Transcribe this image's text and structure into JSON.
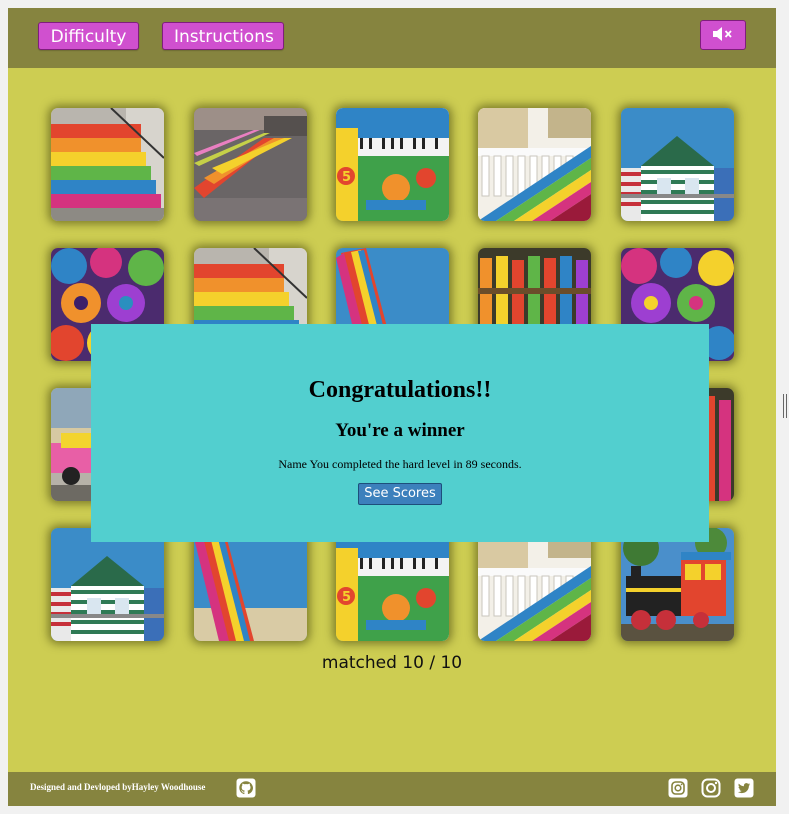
{
  "header": {
    "difficulty_label": "Difficulty",
    "instructions_label": "Instructions",
    "mute_icon": "speaker-muted-icon"
  },
  "cards": [
    {
      "image": "rainbow-stairs"
    },
    {
      "image": "rainbow-crosswalk"
    },
    {
      "image": "painted-piano"
    },
    {
      "image": "rainbow-stair-railing"
    },
    {
      "image": "striped-beach-house"
    },
    {
      "image": "rainbow-roses"
    },
    {
      "image": "rainbow-stairs"
    },
    {
      "image": "striped-deck-chair"
    },
    {
      "image": "rainbow-fence"
    },
    {
      "image": "rainbow-roses"
    },
    {
      "image": "pink-car"
    },
    {
      "image": "hidden-card"
    },
    {
      "image": "hidden-card"
    },
    {
      "image": "hidden-card"
    },
    {
      "image": "rainbow-fence"
    },
    {
      "image": "striped-beach-house"
    },
    {
      "image": "striped-deck-chair"
    },
    {
      "image": "painted-piano"
    },
    {
      "image": "rainbow-stair-railing"
    },
    {
      "image": "colorful-steam-train"
    }
  ],
  "status": {
    "matched_text": "matched 10 / 10",
    "matched": 10,
    "total": 10
  },
  "modal": {
    "title": "Congratulations!!",
    "subtitle": "You're a winner",
    "message": "Name You completed the hard level in 89 seconds.",
    "button_label": "See Scores"
  },
  "footer": {
    "credit": "Designed and Devloped byHayley Woodhouse",
    "icons": [
      "github-icon",
      "instagram-icon",
      "instagram-icon",
      "twitter-icon"
    ]
  },
  "colors": {
    "page_bg": "#cdcd52",
    "bar_bg": "#86843f",
    "button_magenta": "#d050cf",
    "modal_teal": "#52cfcf",
    "modal_button_blue": "#3c80bc"
  }
}
